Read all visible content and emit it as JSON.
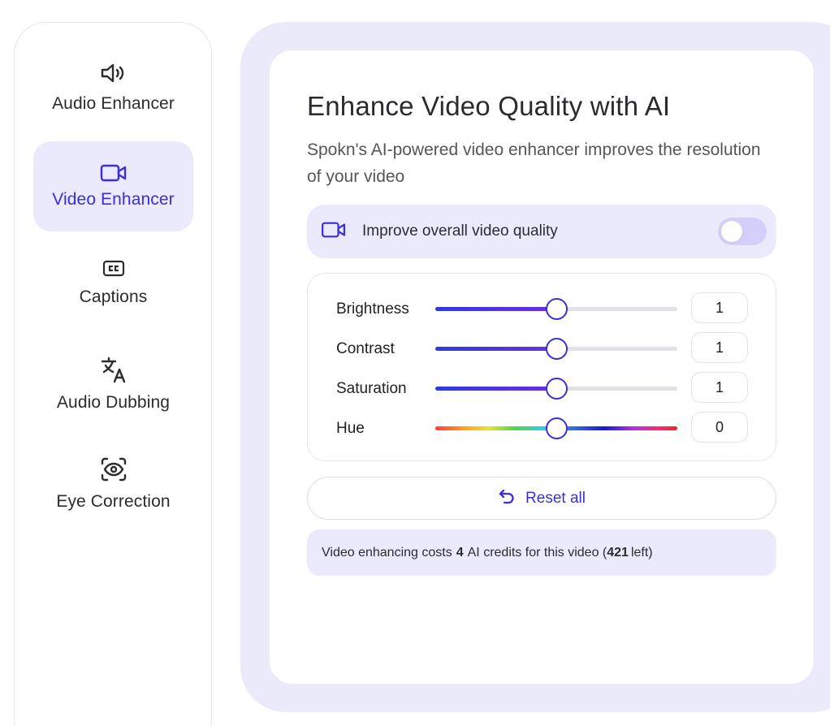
{
  "sidebar": {
    "items": [
      {
        "label": "Audio Enhancer",
        "icon": "speaker-icon",
        "active": false
      },
      {
        "label": "Video Enhancer",
        "icon": "video-camera-icon",
        "active": true
      },
      {
        "label": "Captions",
        "icon": "closed-captions-icon",
        "active": false
      },
      {
        "label": "Audio Dubbing",
        "icon": "translate-icon",
        "active": false
      },
      {
        "label": "Eye Correction",
        "icon": "eye-focus-icon",
        "active": false
      }
    ]
  },
  "main": {
    "title": "Enhance Video Quality with AI",
    "subtitle": "Spokn's AI-powered video enhancer improves the resolution of your video",
    "toggle": {
      "label": "Improve overall video quality",
      "on": false
    },
    "sliders": [
      {
        "label": "Brightness",
        "value": "1",
        "fraction": 0.5,
        "type": "standard"
      },
      {
        "label": "Contrast",
        "value": "1",
        "fraction": 0.5,
        "type": "standard"
      },
      {
        "label": "Saturation",
        "value": "1",
        "fraction": 0.5,
        "type": "standard"
      },
      {
        "label": "Hue",
        "value": "0",
        "fraction": 0.5,
        "type": "hue"
      }
    ],
    "reset_label": "Reset all",
    "credits": {
      "prefix": "Video enhancing costs",
      "cost": "4",
      "middle": "AI credits for this video (",
      "remaining": "421",
      "suffix": "left)"
    }
  },
  "colors": {
    "accent": "#3a2fd8",
    "active_bg": "#ebe9fc",
    "panel_bg": "#ebeafb"
  }
}
